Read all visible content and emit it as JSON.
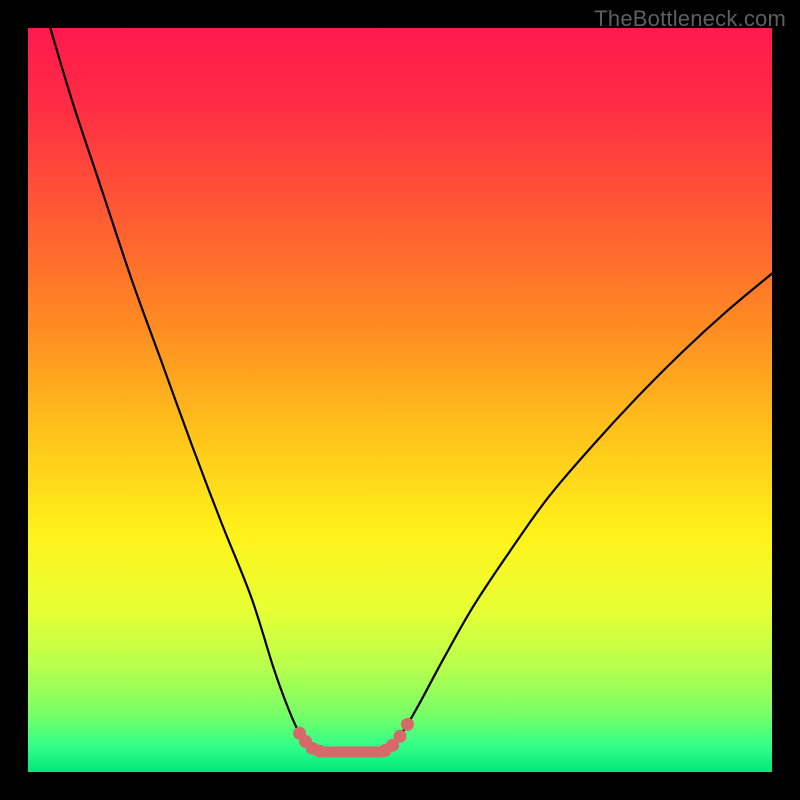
{
  "watermark": "TheBottleneck.com",
  "colors": {
    "frame": "#000000",
    "gradient_stops": [
      {
        "offset": 0.0,
        "color": "#ff1a4d"
      },
      {
        "offset": 0.1,
        "color": "#ff2b44"
      },
      {
        "offset": 0.25,
        "color": "#ff5a33"
      },
      {
        "offset": 0.4,
        "color": "#ff8b22"
      },
      {
        "offset": 0.55,
        "color": "#ffc51a"
      },
      {
        "offset": 0.68,
        "color": "#fff21a"
      },
      {
        "offset": 0.78,
        "color": "#e8ff33"
      },
      {
        "offset": 0.86,
        "color": "#b6ff4d"
      },
      {
        "offset": 0.92,
        "color": "#7aff66"
      },
      {
        "offset": 0.965,
        "color": "#33ff88"
      },
      {
        "offset": 1.0,
        "color": "#00e77a"
      }
    ],
    "curve": "#000000",
    "marker": "#d66a6a"
  },
  "chart_data": {
    "type": "line",
    "title": "",
    "xlabel": "",
    "ylabel": "",
    "xlim": [
      0,
      100
    ],
    "ylim": [
      0,
      100
    ],
    "left_curve": [
      {
        "x": 3.0,
        "y": 100.0
      },
      {
        "x": 6.0,
        "y": 90.0
      },
      {
        "x": 10.0,
        "y": 78.0
      },
      {
        "x": 14.0,
        "y": 66.0
      },
      {
        "x": 18.0,
        "y": 55.0
      },
      {
        "x": 22.0,
        "y": 44.0
      },
      {
        "x": 26.0,
        "y": 33.5
      },
      {
        "x": 30.0,
        "y": 23.5
      },
      {
        "x": 33.0,
        "y": 14.0
      },
      {
        "x": 35.0,
        "y": 8.5
      },
      {
        "x": 36.5,
        "y": 5.2
      },
      {
        "x": 38.0,
        "y": 3.4
      },
      {
        "x": 40.0,
        "y": 2.7
      }
    ],
    "flat_segment": [
      {
        "x": 40.0,
        "y": 2.7
      },
      {
        "x": 47.5,
        "y": 2.7
      }
    ],
    "right_curve": [
      {
        "x": 47.5,
        "y": 2.7
      },
      {
        "x": 49.0,
        "y": 3.6
      },
      {
        "x": 50.5,
        "y": 5.6
      },
      {
        "x": 52.5,
        "y": 9.0
      },
      {
        "x": 56.0,
        "y": 15.5
      },
      {
        "x": 60.0,
        "y": 22.5
      },
      {
        "x": 65.0,
        "y": 30.0
      },
      {
        "x": 70.0,
        "y": 37.0
      },
      {
        "x": 76.0,
        "y": 44.0
      },
      {
        "x": 82.0,
        "y": 50.5
      },
      {
        "x": 88.0,
        "y": 56.5
      },
      {
        "x": 94.0,
        "y": 62.0
      },
      {
        "x": 100.0,
        "y": 67.0
      }
    ],
    "markers": [
      {
        "x": 36.5,
        "y": 5.2
      },
      {
        "x": 37.3,
        "y": 4.1
      },
      {
        "x": 38.2,
        "y": 3.2
      },
      {
        "x": 39.2,
        "y": 2.8
      },
      {
        "x": 48.0,
        "y": 2.9
      },
      {
        "x": 49.0,
        "y": 3.6
      },
      {
        "x": 50.0,
        "y": 4.8
      },
      {
        "x": 51.0,
        "y": 6.4
      }
    ]
  }
}
